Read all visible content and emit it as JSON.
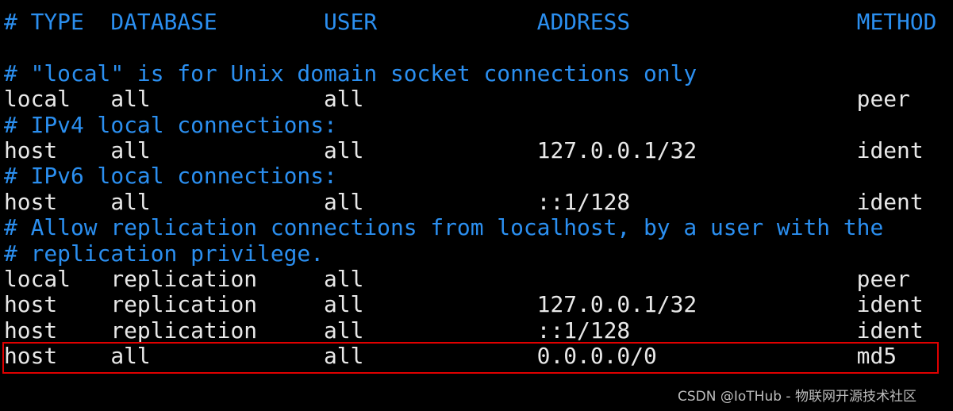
{
  "colors": {
    "comment": "#2b8ff0",
    "text": "#e8e8e8",
    "highlight_border": "#e00000",
    "background": "#000000"
  },
  "lines": [
    {
      "text": "# TYPE  DATABASE        USER            ADDRESS                 METHOD",
      "type": "comment"
    },
    {
      "text": "",
      "type": "blank"
    },
    {
      "text": "# \"local\" is for Unix domain socket connections only",
      "type": "comment"
    },
    {
      "text": "local   all             all                                     peer",
      "type": "entry"
    },
    {
      "text": "# IPv4 local connections:",
      "type": "comment"
    },
    {
      "text": "host    all             all             127.0.0.1/32            ident",
      "type": "entry"
    },
    {
      "text": "# IPv6 local connections:",
      "type": "comment"
    },
    {
      "text": "host    all             all             ::1/128                 ident",
      "type": "entry"
    },
    {
      "text": "# Allow replication connections from localhost, by a user with the",
      "type": "comment"
    },
    {
      "text": "# replication privilege.",
      "type": "comment"
    },
    {
      "text": "local   replication     all                                     peer",
      "type": "entry"
    },
    {
      "text": "host    replication     all             127.0.0.1/32            ident",
      "type": "entry"
    },
    {
      "text": "host    replication     all             ::1/128                 ident",
      "type": "entry"
    },
    {
      "text": "host    all             all             0.0.0.0/0               md5",
      "type": "entry",
      "highlighted": true
    }
  ],
  "watermark": "CSDN @IoTHub - 物联网开源技术社区"
}
